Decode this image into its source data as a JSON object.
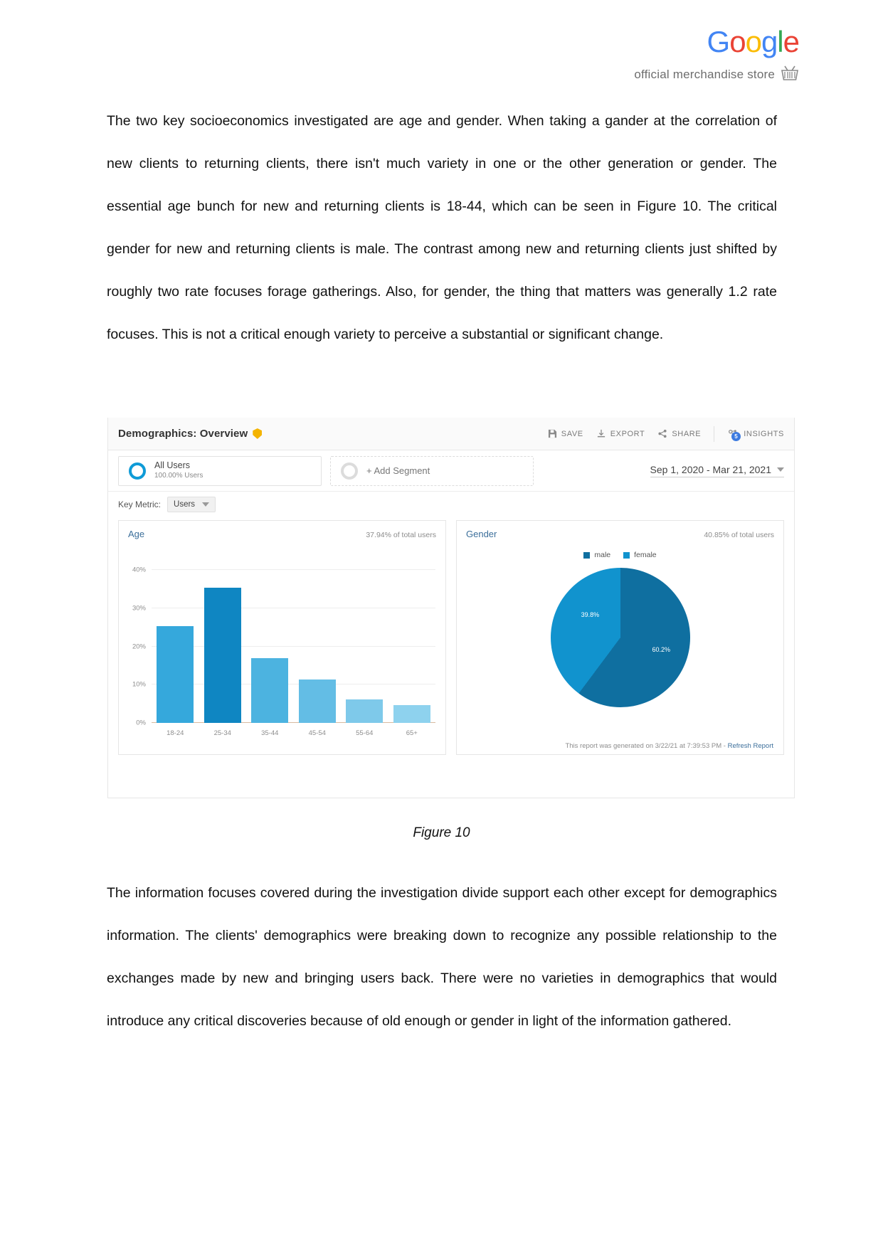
{
  "header": {
    "logo_letters": [
      {
        "ch": "G",
        "color": "#4285F4"
      },
      {
        "ch": "o",
        "color": "#EA4335"
      },
      {
        "ch": "o",
        "color": "#FBBC05"
      },
      {
        "ch": "g",
        "color": "#4285F4"
      },
      {
        "ch": "l",
        "color": "#34A853"
      },
      {
        "ch": "e",
        "color": "#EA4335"
      }
    ],
    "store_text": "official merchandise store",
    "basket_icon": "shopping-basket-icon"
  },
  "document": {
    "paragraph_1": "The two key socioeconomics investigated are age and gender. When taking a gander at the correlation of new clients to returning clients, there isn't much variety in one or the other generation or gender. The essential age bunch for new and returning clients is 18-44, which can be seen in Figure 10. The critical gender for new and returning clients is male. The contrast among new and returning clients just shifted by roughly two rate focuses forage gatherings. Also, for gender, the thing that matters was generally 1.2 rate focuses. This is not a critical enough variety to perceive a substantial or significant change.",
    "figure_caption": "Figure 10",
    "paragraph_2": "The information focuses covered during the investigation divide support each other except for demographics information. The clients' demographics were breaking down to recognize any possible relationship to the exchanges made by new and bringing users back. There were no varieties in demographics that would introduce any critical discoveries because of old enough or gender in light of the information gathered."
  },
  "analytics": {
    "title": "Demographics: Overview",
    "verified_badge_icon": "shield-check-icon",
    "actions": [
      {
        "label": "SAVE",
        "icon": "save-icon"
      },
      {
        "label": "EXPORT",
        "icon": "download-icon"
      },
      {
        "label": "SHARE",
        "icon": "share-icon"
      },
      {
        "label": "INSIGHTS",
        "icon": "insights-icon",
        "badge": "5"
      }
    ],
    "segments": {
      "all_users_name": "All Users",
      "all_users_sub": "100.00% Users",
      "add_segment_label": "+ Add Segment"
    },
    "date_range": "Sep 1, 2020 - Mar 21, 2021",
    "key_metric": {
      "label": "Key Metric:",
      "value": "Users"
    },
    "footer": {
      "text": "This report was generated on 3/22/21 at 7:39:53 PM - ",
      "link": "Refresh Report"
    }
  },
  "chart_data": [
    {
      "type": "bar",
      "title": "Age",
      "subtitle": "37.94% of total users",
      "categories": [
        "18-24",
        "25-34",
        "35-44",
        "45-54",
        "55-64",
        "65+"
      ],
      "values": [
        25.3,
        35.5,
        17.0,
        11.3,
        6.2,
        4.6
      ],
      "colors": [
        "#35a8dc",
        "#0f86c2",
        "#4cb3e0",
        "#63bde5",
        "#7ec9ea",
        "#8ed2ee"
      ],
      "ytick_labels": [
        "0%",
        "10%",
        "20%",
        "30%",
        "40%"
      ],
      "ytick_values": [
        0,
        10,
        20,
        30,
        40
      ],
      "ylim": [
        0,
        44
      ],
      "xlabel": "",
      "ylabel": "",
      "grid": true
    },
    {
      "type": "pie",
      "title": "Gender",
      "subtitle": "40.85% of total users",
      "labels": [
        "male",
        "female"
      ],
      "values": [
        60.2,
        39.8
      ],
      "value_labels": [
        "60.2%",
        "39.8%"
      ],
      "colors": [
        "#0f6fa0",
        "#1193ce"
      ],
      "legend_position": "top"
    }
  ]
}
